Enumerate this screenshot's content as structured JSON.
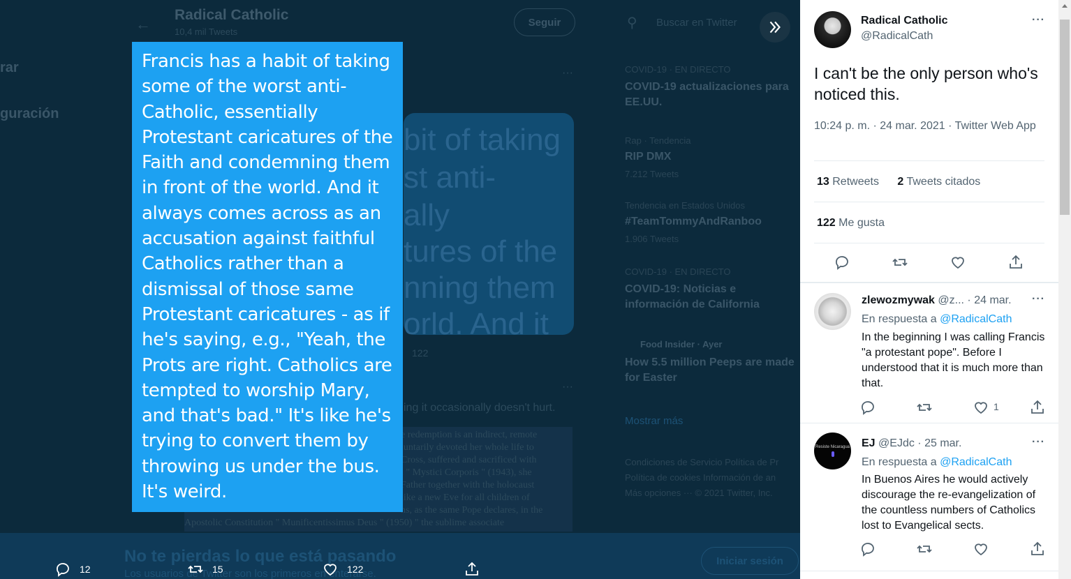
{
  "background": {
    "nav_partial_1": "rar",
    "nav_partial_2": "guración",
    "profile_name": "Radical Catholic",
    "profile_tweets": "10,4 mil Tweets",
    "follow_label": "Seguir",
    "search_placeholder": "Buscar en Twitter",
    "trends": [
      {
        "meta": "COVID-19 · EN DIRECTO",
        "title": "COVID-19 actualizaciones para",
        "title2": "EE.UU."
      },
      {
        "meta": "Rap · Tendencia",
        "title": "RIP DMX",
        "count": "7.212 Tweets"
      },
      {
        "meta": "Tendencia en Estados Unidos",
        "title": "#TeamTommyAndRanboo",
        "count": "1.906 Tweets"
      },
      {
        "meta": "COVID-19 · EN DIRECTO",
        "title": "COVID-19: Noticias e",
        "title2": "información de California"
      },
      {
        "meta": "Food Insider · Ayer",
        "title": "How 5.5 million Peeps are made",
        "title2": "for Easter"
      }
    ],
    "show_more": "Mostrar más",
    "footer_1": "Condiciones de Servicio   Política de Pr",
    "footer_2": "Política de cookies   Información de an",
    "footer_3": "Más opciones ···   © 2021 Twitter, Inc.",
    "ghost_words": [
      "bit of taking",
      "st anti-",
      "ally",
      "tures of the",
      "nning them",
      "orld. And it"
    ],
    "partial_tweet": "ing it occasionally doesn't hurt.",
    "newspaper_lines": [
      "e redemption is an indirect, remote",
      "luntarily devoted her whole life to",
      "Cross, suffered and sacrificed with",
      "l \" Mystici Corporis \" (1943), she",
      "Father together with the holocaust",
      "like a new Eve for all children of",
      "ns, as the same Pope declares, in the"
    ],
    "newspaper_bottom": "Apostolic Constitution \" Munificentissimus Deus \" (1950) \" the sublime associate",
    "bottom_title": "No te pierdas lo que está pasando",
    "bottom_sub": "Los usuarios de Twitter son los primeros en enterarse.",
    "login_label": "Iniciar sesión"
  },
  "overlay_actions": {
    "replies": "12",
    "retweets": "15",
    "likes": "122"
  },
  "quote_lines": [
    "Francis has a habit of taking",
    "some of the worst anti-",
    "Catholic, essentially",
    "Protestant caricatures of the",
    "Faith and condemning them",
    "in front of the world. And it",
    "always comes across as an",
    "accusation against faithful",
    "Catholics rather than a",
    "dismissal of those same",
    "Protestant caricatures - as if",
    "he's saying, e.g., \"Yeah, the",
    "Prots are right. Catholics are",
    "tempted to worship Mary,",
    "and that's bad.\" It's like he's",
    "trying to convert them by",
    "throwing us under the bus.",
    "It's weird."
  ],
  "tweet": {
    "display_name": "Radical Catholic",
    "handle": "@RadicalCath",
    "text": "I can't be the only person who's noticed this.",
    "time": "10:24 p. m. · 24 mar. 2021 · Twitter Web App",
    "retweets_count": "13",
    "retweets_label": "Retweets",
    "quotes_count": "2",
    "quotes_label": "Tweets citados",
    "likes_count": "122",
    "likes_label": "Me gusta"
  },
  "replies": [
    {
      "name": "zlewozmywak",
      "handle": "@z...",
      "date": "· 24 mar.",
      "reply_prefix": "En respuesta a",
      "reply_to": "@RadicalCath",
      "text": "In the beginning I was calling Francis \"a protestant pope\". Before I understood that it is much more than that.",
      "likes": "1"
    },
    {
      "name": "EJ",
      "handle": "@EJdc",
      "date": "· 25 mar.",
      "reply_prefix": "En respuesta a",
      "reply_to": "@RadicalCath",
      "text": "In Buenos Aires he would actively discourage the re-evangelization of the countless numbers of Catholics lost to Evangelical sects.",
      "avatar_text": "Resiste Nicaragua"
    }
  ],
  "colors": {
    "accent": "#1da1f2",
    "quote_bg": "#1da1f2",
    "overlay_bg": "#0c2a3c"
  }
}
